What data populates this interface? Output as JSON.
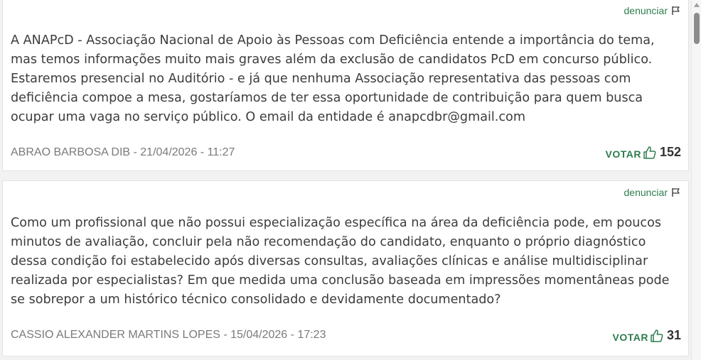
{
  "colors": {
    "accent": "#2e7d4f",
    "author": "#7a7a7a",
    "text": "#3c3c3c"
  },
  "comments": [
    {
      "report_label": "denunciar",
      "text": "A ANAPcD - Associação Nacional de Apoio às Pessoas com Deficiência entende a importância do tema, mas temos informações muito mais graves além da exclusão de candidatos PcD em concurso público. Estaremos presencial no Auditório - e já que nenhuma Associação representativa das pessoas com deficiência compoe a mesa, gostaríamos de ter essa oportunidade de contribuição para quem busca ocupar uma vaga no serviço público. O email da entidade é anapcdbr@gmail.com",
      "author_line": "ABRAO BARBOSA DIB - 21/04/2026 - 11:27",
      "vote_label": "VOTAR",
      "votes": "152"
    },
    {
      "report_label": "denunciar",
      "text": "Como um profissional que não possui especialização específica na área da deficiência pode, em poucos minutos de avaliação, concluir pela não recomendação do candidato, enquanto o próprio diagnóstico dessa condição foi estabelecido após diversas consultas, avaliações clínicas e análise multidisciplinar realizada por especialistas? Em que medida uma conclusão baseada em impressões momentâneas pode se sobrepor a um histórico técnico consolidado e devidamente documentado?",
      "author_line": "CASSIO ALEXANDER MARTINS LOPES - 15/04/2026 - 17:23",
      "vote_label": "VOTAR",
      "votes": "31"
    }
  ],
  "icons": {
    "report": "flag-icon",
    "vote": "thumbs-up-icon"
  }
}
